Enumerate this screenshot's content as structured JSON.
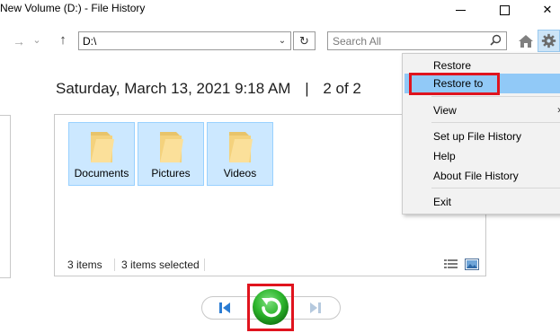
{
  "window": {
    "title": "New Volume (D:) - File History",
    "close_glyph": "✕"
  },
  "nav": {
    "back_glyph": "←",
    "forward_glyph": "→",
    "dropdown_glyph": "⌄",
    "up_glyph": "↑",
    "address": "D:\\",
    "address_dropdown_glyph": "⌄",
    "refresh_glyph": "↻",
    "search_placeholder": "Search All",
    "search_glyph": "⚲"
  },
  "heading": {
    "date": "Saturday, March 13, 2021 9:18 AM",
    "separator": "|",
    "position": "2 of 2"
  },
  "folders": [
    {
      "name": "Documents"
    },
    {
      "name": "Pictures"
    },
    {
      "name": "Videos"
    }
  ],
  "status": {
    "item_count": "3 items",
    "selected_count": "3 items selected"
  },
  "menu": {
    "restore": "Restore",
    "restore_to": "Restore to",
    "view": "View",
    "view_arrow": "›",
    "setup": "Set up File History",
    "help": "Help",
    "about": "About File History",
    "exit": "Exit"
  },
  "colors": {
    "restore_button": "#2cb52c",
    "highlight_border": "#e0141e",
    "selection": "#cce8ff",
    "menu_hover": "#91c9f7",
    "arrow_blue": "#2b7cd3"
  }
}
